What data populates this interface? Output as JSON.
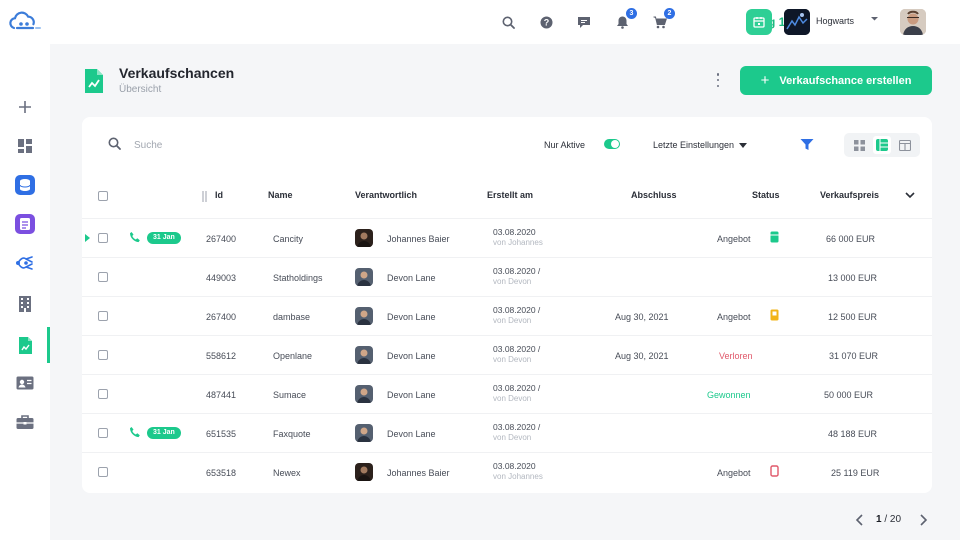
{
  "app": {
    "brand_icon": "cloud-logo-icon",
    "accent_color": "#1cc98c"
  },
  "sidebar": {
    "items": [
      {
        "name": "plus-icon"
      },
      {
        "name": "dashboard-icon"
      },
      {
        "name": "database-app-icon"
      },
      {
        "name": "notes-app-icon"
      },
      {
        "name": "network-icon"
      },
      {
        "name": "building-icon"
      },
      {
        "name": "document-icon",
        "active": true
      },
      {
        "name": "contact-card-icon"
      },
      {
        "name": "briefcase-icon"
      }
    ]
  },
  "topbar": {
    "icons": [
      "search-icon",
      "help-icon",
      "chat-icon",
      "bell-icon",
      "cart-icon"
    ],
    "bell_badge": "3",
    "cart_badge": "2",
    "date_label": "Aug 1",
    "org_name": "Hogwarts"
  },
  "page": {
    "title": "Verkaufschancen",
    "subtitle": "Übersicht",
    "create_button": "Verkaufschance erstellen"
  },
  "toolbar": {
    "search_placeholder": "Suche",
    "active_only_label": "Nur Aktive",
    "active_only": true,
    "settings_label": "Letzte Einstellungen"
  },
  "table": {
    "headers": {
      "id": "Id",
      "name": "Name",
      "owner": "Verantwortlich",
      "created": "Erstellt am",
      "closing": "Abschluss",
      "status": "Status",
      "price": "Verkaufspreis"
    },
    "rows": [
      {
        "expanded": true,
        "call_badge": "31 Jan",
        "id": "267400",
        "name": "Cancity",
        "owner": "Johannes Baier",
        "owner_avatar": "jb",
        "created": "03.08.2020",
        "created_by": "von Johannes",
        "closing": "",
        "status": "Angebot",
        "status_color": "#1cc98c",
        "status_icon": "green-bar-icon",
        "price": "66 000 EUR"
      },
      {
        "expanded": false,
        "call_badge": "",
        "id": "449003",
        "name": "Statholdings",
        "owner": "Devon Lane",
        "owner_avatar": "dl",
        "created": "03.08.2020 /",
        "created_by": "von Devon",
        "closing": "",
        "status": "",
        "status_color": "",
        "status_icon": "",
        "price": "13 000 EUR"
      },
      {
        "expanded": false,
        "call_badge": "",
        "id": "267400",
        "name": "dambase",
        "owner": "Devon Lane",
        "owner_avatar": "dl",
        "created": "03.08.2020 /",
        "created_by": "von Devon",
        "closing": "Aug 30, 2021",
        "status": "Angebot",
        "status_color": "#f2b418",
        "status_icon": "yellow-bar-icon",
        "price": "12 500 EUR"
      },
      {
        "expanded": false,
        "call_badge": "",
        "id": "558612",
        "name": "Openlane",
        "owner": "Devon Lane",
        "owner_avatar": "dl",
        "created": "03.08.2020 /",
        "created_by": "von Devon",
        "closing": "Aug 30, 2021",
        "status": "Verloren",
        "status_color": "#e0586a",
        "status_icon": "",
        "price": "31 070 EUR"
      },
      {
        "expanded": false,
        "call_badge": "",
        "id": "487441",
        "name": "Sumace",
        "owner": "Devon Lane",
        "owner_avatar": "dl",
        "created": "03.08.2020 /",
        "created_by": "von Devon",
        "closing": "",
        "status": "Gewonnen",
        "status_color": "#1cc98c",
        "status_icon": "",
        "price": "50 000 EUR"
      },
      {
        "expanded": false,
        "call_badge": "31 Jan",
        "id": "651535",
        "name": "Faxquote",
        "owner": "Devon Lane",
        "owner_avatar": "dl",
        "created": "03.08.2020 /",
        "created_by": "von Devon",
        "closing": "",
        "status": "",
        "status_color": "",
        "status_icon": "",
        "price": "48 188 EUR"
      },
      {
        "expanded": false,
        "call_badge": "",
        "id": "653518",
        "name": "Newex",
        "owner": "Johannes Baier",
        "owner_avatar": "jb",
        "created": "03.08.2020",
        "created_by": "von Johannes",
        "closing": "",
        "status": "Angebot",
        "status_color": "#e0586a",
        "status_icon": "red-outline-bar-icon",
        "price": "25 119 EUR"
      }
    ]
  },
  "pagination": {
    "current": "1",
    "total": "20",
    "separator": "/"
  }
}
